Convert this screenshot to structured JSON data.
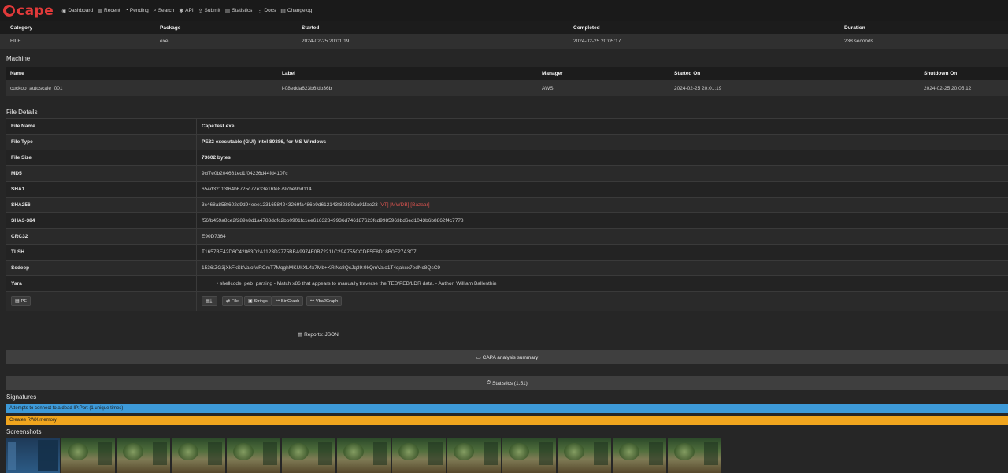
{
  "nav": {
    "brand": "cape",
    "items": [
      {
        "icon": "dashboard-icon",
        "glyph": "◉",
        "label": "Dashboard"
      },
      {
        "icon": "recent-icon",
        "glyph": "≣",
        "label": "Recent"
      },
      {
        "icon": "pending-icon",
        "glyph": "◔",
        "label": "Pending"
      },
      {
        "icon": "search-icon",
        "glyph": "⌕",
        "label": "Search"
      },
      {
        "icon": "api-icon",
        "glyph": "✱",
        "label": "API"
      },
      {
        "icon": "submit-icon",
        "glyph": "⇪",
        "label": "Submit"
      },
      {
        "icon": "statistics-icon",
        "glyph": "▥",
        "label": "Statistics"
      },
      {
        "icon": "docs-icon",
        "glyph": "⋮",
        "label": "Docs"
      },
      {
        "icon": "changelog-icon",
        "glyph": "▤",
        "label": "Changelog"
      }
    ]
  },
  "summary": {
    "headers": [
      "Category",
      "Package",
      "Started",
      "Completed",
      "Duration"
    ],
    "values": [
      "FILE",
      "exe",
      "2024-02-25 20:01:19",
      "2024-02-25 20:05:17",
      "238 seconds"
    ]
  },
  "machine": {
    "title": "Machine",
    "headers": [
      "Name",
      "Label",
      "Manager",
      "Started On",
      "Shutdown On"
    ],
    "values": [
      "cuckoo_autoscale_001",
      "i-08edda623b6fdb36b",
      "AWS",
      "2024-02-25 20:01:19",
      "2024-02-25 20:05:12"
    ]
  },
  "file_details": {
    "title": "File Details",
    "file_name_key": "File Name",
    "file_name": "CapeTest.exe",
    "file_type_key": "File Type",
    "file_type": "PE32 executable (GUI) Intel 80386, for MS Windows",
    "file_size_key": "File Size",
    "file_size": "73602 bytes",
    "md5_key": "MD5",
    "md5": "9cf7e0b204661ed1f04236d44fd4107c",
    "sha1_key": "SHA1",
    "sha1": "654d32113f64b6725c77e33e16fe8797be9bd114",
    "sha256_key": "SHA256",
    "sha256": "3c468a858f602d9d94eee12316584243269fa486e9d612143f82389ba91fae23",
    "sha256_links": "[VT] [MWDB] [Bazaar]",
    "sha3_key": "SHA3-384",
    "sha3": "f56fb459a8ce2f289e8d1a4783ddfc2bb0901fc1ee61632849936d746187623fcd9985963bd6ed1043b6b8862f4c7778",
    "crc32_key": "CRC32",
    "crc32": "E90D7364",
    "tlsh_key": "TLSH",
    "tlsh": "T1657BE42D6C42863D2A1123D2775BBA9974F0B72211C29A755CCDF5E8D18B0E27A3C7",
    "ssdeep_key": "Ssdeep",
    "ssdeep": "1536:ZG3jXkFkSbValofwRCmT7MqghMKUkXL4x7Mb+KRlNc8QsJq39:9kQmValo1T4qakcx7edNc8QsC9",
    "yara_key": "Yara",
    "yara": "shellcode_peb_parsing - Match x86 that appears to manually traverse the TEB/PEB/LDR data. - Author: William Ballenthin",
    "pe_button": "PE",
    "buttons": [
      "File",
      "Strings",
      "BinGraph",
      "Vba2Graph"
    ]
  },
  "reports": "Reports: JSON",
  "capa": "CAPA analysis summary",
  "statistics": "Statistics (1.51)",
  "signatures": {
    "title": "Signatures",
    "items": [
      {
        "text": "Attempts to connect to a dead IP:Port (1 unique times)",
        "color": "#3d9ad9"
      },
      {
        "text": "Creates RWX memory",
        "color": "#f0a51e"
      }
    ]
  },
  "screenshots": {
    "title": "Screenshots"
  }
}
